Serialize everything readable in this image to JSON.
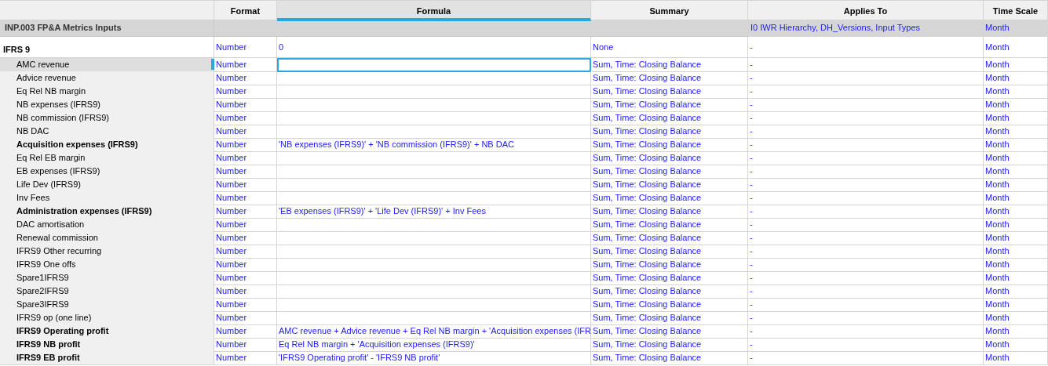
{
  "columns": [
    {
      "label": "Format",
      "selected": false
    },
    {
      "label": "Formula",
      "selected": true
    },
    {
      "label": "Summary",
      "selected": false
    },
    {
      "label": "Applies To",
      "selected": false
    },
    {
      "label": "Time Scale",
      "selected": false
    }
  ],
  "section": {
    "name": "INP.003 FP&A Metrics Inputs",
    "applies_to": "I0 IWR Hierarchy, DH_Versions, Input Types",
    "time_scale": "Month"
  },
  "group": {
    "name": "IFRS 9",
    "format": "Number",
    "formula": "0",
    "summary": "None",
    "applies_to": "-",
    "time_scale": "Month"
  },
  "rows": [
    {
      "name": "AMC revenue",
      "bold": false,
      "selected": true,
      "format": "Number",
      "formula": "",
      "summary": "Sum, Time: Closing Balance",
      "applies_to": "-",
      "time_scale": "Month"
    },
    {
      "name": "Advice revenue",
      "bold": false,
      "selected": false,
      "format": "Number",
      "formula": "",
      "summary": "Sum, Time: Closing Balance",
      "applies_to": "-",
      "time_scale": "Month"
    },
    {
      "name": "Eq Rel NB margin",
      "bold": false,
      "selected": false,
      "format": "Number",
      "formula": "",
      "summary": "Sum, Time: Closing Balance",
      "applies_to": "-",
      "time_scale": "Month"
    },
    {
      "name": "NB expenses (IFRS9)",
      "bold": false,
      "selected": false,
      "format": "Number",
      "formula": "",
      "summary": "Sum, Time: Closing Balance",
      "applies_to": "-",
      "time_scale": "Month"
    },
    {
      "name": "NB commission (IFRS9)",
      "bold": false,
      "selected": false,
      "format": "Number",
      "formula": "",
      "summary": "Sum, Time: Closing Balance",
      "applies_to": "-",
      "time_scale": "Month"
    },
    {
      "name": "NB DAC",
      "bold": false,
      "selected": false,
      "format": "Number",
      "formula": "",
      "summary": "Sum, Time: Closing Balance",
      "applies_to": "-",
      "time_scale": "Month"
    },
    {
      "name": "Acquisition expenses (IFRS9)",
      "bold": true,
      "selected": false,
      "format": "Number",
      "formula": "'NB expenses (IFRS9)' + 'NB commission (IFRS9)' + NB DAC",
      "summary": "Sum, Time: Closing Balance",
      "applies_to": "-",
      "time_scale": "Month"
    },
    {
      "name": "Eq Rel EB margin",
      "bold": false,
      "selected": false,
      "format": "Number",
      "formula": "",
      "summary": "Sum, Time: Closing Balance",
      "applies_to": "-",
      "time_scale": "Month"
    },
    {
      "name": "EB expenses (IFRS9)",
      "bold": false,
      "selected": false,
      "format": "Number",
      "formula": "",
      "summary": "Sum, Time: Closing Balance",
      "applies_to": "-",
      "time_scale": "Month"
    },
    {
      "name": "Life Dev (IFRS9)",
      "bold": false,
      "selected": false,
      "format": "Number",
      "formula": "",
      "summary": "Sum, Time: Closing Balance",
      "applies_to": "-",
      "time_scale": "Month"
    },
    {
      "name": "Inv Fees",
      "bold": false,
      "selected": false,
      "format": "Number",
      "formula": "",
      "summary": "Sum, Time: Closing Balance",
      "applies_to": "-",
      "time_scale": "Month"
    },
    {
      "name": "Administration expenses (IFRS9)",
      "bold": true,
      "selected": false,
      "format": "Number",
      "formula": "'EB expenses (IFRS9)' + 'Life Dev (IFRS9)' + Inv Fees",
      "summary": "Sum, Time: Closing Balance",
      "applies_to": "-",
      "time_scale": "Month"
    },
    {
      "name": "DAC amortisation",
      "bold": false,
      "selected": false,
      "format": "Number",
      "formula": "",
      "summary": "Sum, Time: Closing Balance",
      "applies_to": "-",
      "time_scale": "Month"
    },
    {
      "name": "Renewal commission",
      "bold": false,
      "selected": false,
      "format": "Number",
      "formula": "",
      "summary": "Sum, Time: Closing Balance",
      "applies_to": "-",
      "time_scale": "Month"
    },
    {
      "name": "IFRS9 Other recurring",
      "bold": false,
      "selected": false,
      "format": "Number",
      "formula": "",
      "summary": "Sum, Time: Closing Balance",
      "applies_to": "-",
      "time_scale": "Month"
    },
    {
      "name": "IFRS9 One offs",
      "bold": false,
      "selected": false,
      "format": "Number",
      "formula": "",
      "summary": "Sum, Time: Closing Balance",
      "applies_to": "-",
      "time_scale": "Month"
    },
    {
      "name": "Spare1IFRS9",
      "bold": false,
      "selected": false,
      "format": "Number",
      "formula": "",
      "summary": "Sum, Time: Closing Balance",
      "applies_to": "-",
      "time_scale": "Month"
    },
    {
      "name": "Spare2IFRS9",
      "bold": false,
      "selected": false,
      "format": "Number",
      "formula": "",
      "summary": "Sum, Time: Closing Balance",
      "applies_to": "-",
      "time_scale": "Month"
    },
    {
      "name": "Spare3IFRS9",
      "bold": false,
      "selected": false,
      "format": "Number",
      "formula": "",
      "summary": "Sum, Time: Closing Balance",
      "applies_to": "-",
      "time_scale": "Month"
    },
    {
      "name": "IFRS9 op (one line)",
      "bold": false,
      "selected": false,
      "format": "Number",
      "formula": "",
      "summary": "Sum, Time: Closing Balance",
      "applies_to": "-",
      "time_scale": "Month"
    },
    {
      "name": "IFRS9 Operating profit",
      "bold": true,
      "selected": false,
      "format": "Number",
      "formula": "AMC revenue + Advice revenue + Eq Rel NB margin + 'Acquisition expenses (IFR",
      "summary": "Sum, Time: Closing Balance",
      "applies_to": "-",
      "time_scale": "Month"
    },
    {
      "name": "IFRS9 NB profit",
      "bold": true,
      "selected": false,
      "format": "Number",
      "formula": "Eq Rel NB margin + 'Acquisition expenses (IFRS9)'",
      "summary": "Sum, Time: Closing Balance",
      "applies_to": "-",
      "time_scale": "Month"
    },
    {
      "name": "IFRS9 EB profit",
      "bold": true,
      "selected": false,
      "format": "Number",
      "formula": "'IFRS9 Operating profit' - 'IFRS9 NB profit'",
      "summary": "Sum, Time: Closing Balance",
      "applies_to": "-",
      "time_scale": "Month"
    }
  ]
}
